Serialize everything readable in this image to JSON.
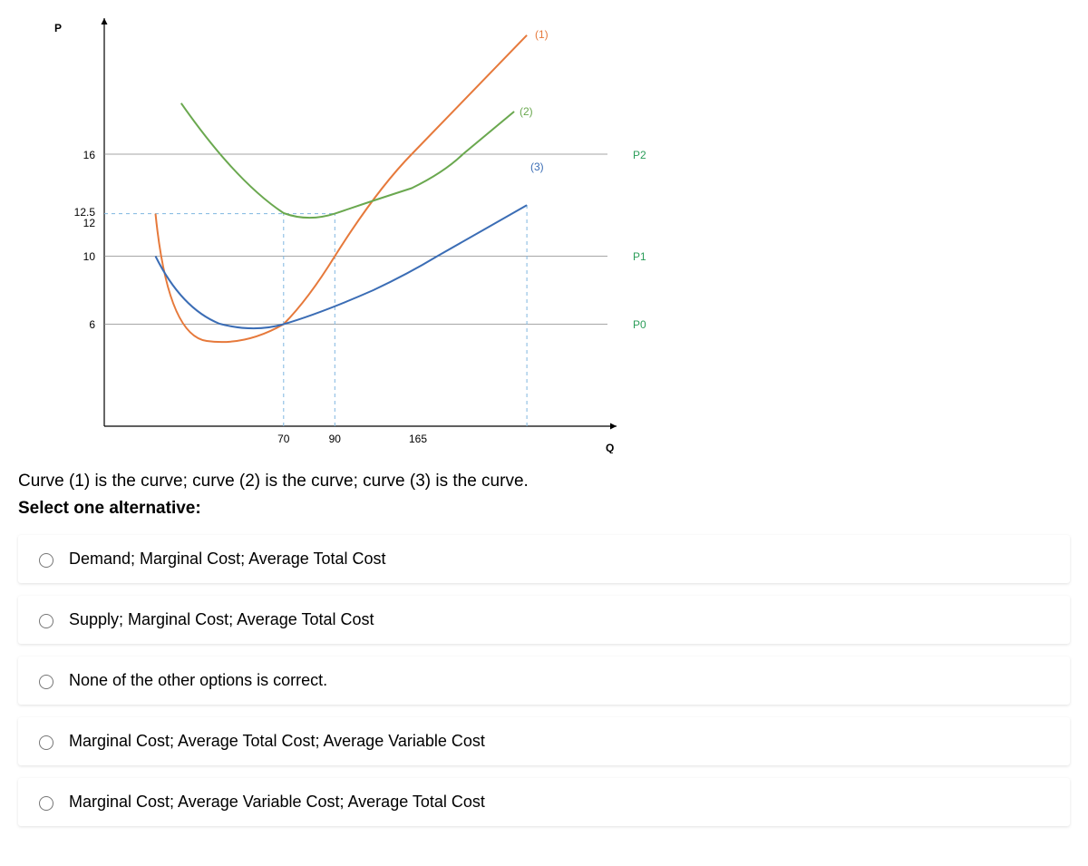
{
  "chart_data": {
    "type": "line",
    "xlabel": "Q",
    "ylabel": "P",
    "x_ticks": [
      70,
      90,
      165
    ],
    "y_ticks": [
      6,
      10,
      12,
      12.5,
      16
    ],
    "price_labels": [
      "P0",
      "P1",
      "P2"
    ],
    "price_label_y": [
      6,
      10,
      16
    ],
    "horizontal_guides_y": [
      6,
      10,
      12.5,
      16
    ],
    "vertical_guides_x": [
      70,
      90,
      165
    ],
    "series": [
      {
        "name": "(1)",
        "color": "#e6793b",
        "role": "MC",
        "points": [
          [
            20,
            12.5
          ],
          [
            30,
            7
          ],
          [
            40,
            5
          ],
          [
            55,
            5
          ],
          [
            70,
            6
          ],
          [
            90,
            10
          ],
          [
            120,
            16
          ],
          [
            165,
            23
          ]
        ]
      },
      {
        "name": "(2)",
        "color": "#6aa84f",
        "role": "ATC",
        "points": [
          [
            30,
            19
          ],
          [
            45,
            16
          ],
          [
            60,
            14
          ],
          [
            75,
            12.8
          ],
          [
            90,
            12.5
          ],
          [
            105,
            12.8
          ],
          [
            120,
            14
          ],
          [
            140,
            16
          ],
          [
            160,
            18.5
          ]
        ]
      },
      {
        "name": "(3)",
        "color": "#3b6db5",
        "role": "AVC",
        "points": [
          [
            20,
            10
          ],
          [
            30,
            8
          ],
          [
            45,
            6.5
          ],
          [
            60,
            6
          ],
          [
            70,
            6
          ],
          [
            85,
            6.5
          ],
          [
            105,
            8
          ],
          [
            130,
            10
          ],
          [
            165,
            13
          ]
        ]
      }
    ],
    "curve_label_positions": [
      [
        175,
        23
      ],
      [
        163,
        18.5
      ],
      [
        168,
        13
      ]
    ]
  },
  "axis": {
    "y": "P",
    "x": "Q"
  },
  "yticks": {
    "t6": "6",
    "t10": "10",
    "t12": "12",
    "t125": "12.5",
    "t16": "16"
  },
  "xticks": {
    "t70": "70",
    "t90": "90",
    "t165": "165"
  },
  "priceLabels": {
    "p0": "P0",
    "p1": "P1",
    "p2": "P2"
  },
  "curveLabels": {
    "c1": "(1)",
    "c2": "(2)",
    "c3": "(3)"
  },
  "question": {
    "text": "Curve (1) is the curve; curve (2) is the curve; curve (3) is the curve.",
    "prompt": "Select one alternative:"
  },
  "options": [
    "Demand; Marginal Cost; Average Total Cost",
    "Supply; Marginal Cost; Average Total Cost",
    "None of the other options is correct.",
    "Marginal Cost; Average Total Cost; Average Variable Cost",
    "Marginal Cost; Average Variable Cost; Average Total Cost"
  ]
}
